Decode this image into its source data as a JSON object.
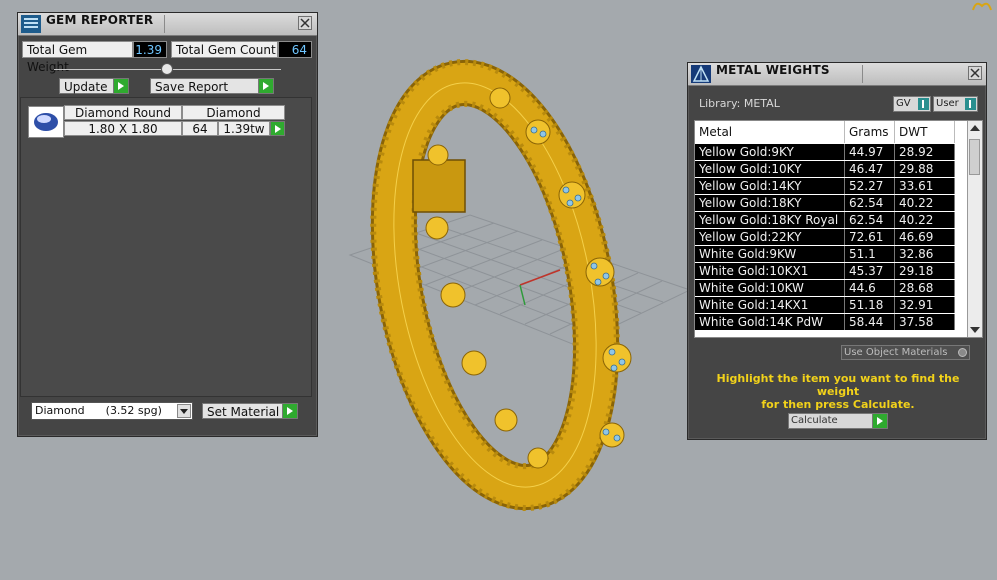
{
  "gem_reporter": {
    "title": "GEM REPORTER",
    "total_weight_label": "Total Gem Weight",
    "total_weight_value": "1.39",
    "total_count_label": "Total Gem Count",
    "total_count_value": "64",
    "update_label": "Update",
    "save_report_label": "Save Report",
    "headers": {
      "shape": "Diamond Round",
      "material": "Diamond"
    },
    "row": {
      "size": "1.80 X 1.80",
      "count": "64",
      "weight": "1.39tw"
    },
    "material_select": "Diamond      (3.52 spg)",
    "set_material_label": "Set Material"
  },
  "metal_weights": {
    "title": "METAL WEIGHTS",
    "library_label": "Library: METAL",
    "toggle_gv": "GV",
    "toggle_user": "User",
    "columns": [
      "Metal",
      "Grams",
      "DWT"
    ],
    "rows": [
      [
        "Yellow Gold:9KY",
        "44.97",
        "28.92"
      ],
      [
        "Yellow Gold:10KY",
        "46.47",
        "29.88"
      ],
      [
        "Yellow Gold:14KY",
        "52.27",
        "33.61"
      ],
      [
        "Yellow Gold:18KY",
        "62.54",
        "40.22"
      ],
      [
        "Yellow Gold:18KY Royal",
        "62.54",
        "40.22"
      ],
      [
        "Yellow Gold:22KY",
        "72.61",
        "46.69"
      ],
      [
        "White Gold:9KW",
        "51.1",
        "32.86"
      ],
      [
        "White Gold:10KX1",
        "45.37",
        "29.18"
      ],
      [
        "White Gold:10KW",
        "44.6",
        "28.68"
      ],
      [
        "White Gold:14KX1",
        "51.18",
        "32.91"
      ],
      [
        "White Gold:14K PdW",
        "58.44",
        "37.58"
      ]
    ],
    "use_object_materials": "Use Object Materials",
    "hint_line1": "Highlight the item you want to find the weight",
    "hint_line2": "for then press Calculate.",
    "calculate_label": "Calculate"
  },
  "colors": {
    "viewport_bg": "#a4a9ad",
    "panel_bg": "#454545",
    "gold": "#d9a514",
    "hint_text": "#f2d21a",
    "value_text": "#6fc6ff",
    "button_arrow": "#2faa2f"
  },
  "icons": [
    "gem-reporter-icon",
    "metal-weights-icon",
    "close-icon",
    "play-arrow-icon",
    "dropdown-arrow-icon"
  ]
}
